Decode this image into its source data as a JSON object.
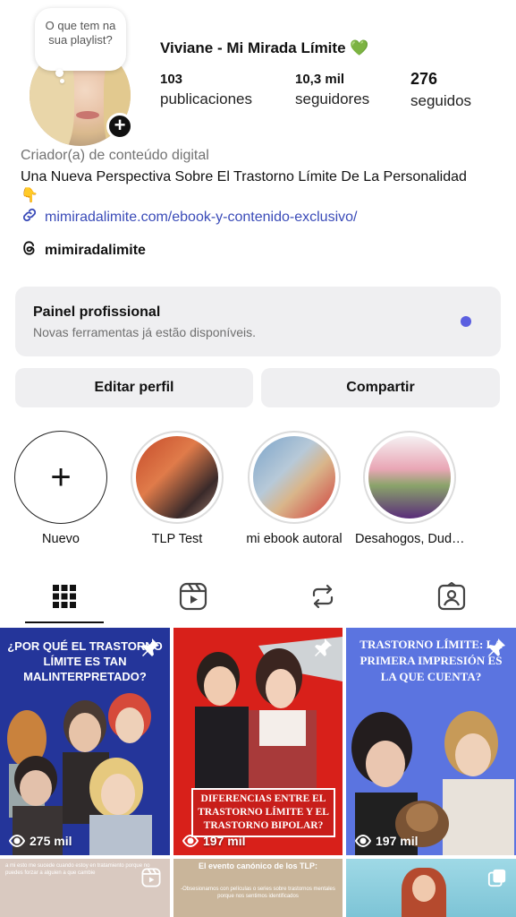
{
  "profile": {
    "note": "O que tem na sua playlist?",
    "display_name": "Viviane - Mi Mirada Límite 💚",
    "stats": [
      {
        "num": "103",
        "label": "publicaciones"
      },
      {
        "num": "10,3 mil",
        "label": "seguidores"
      },
      {
        "num": "276",
        "label": "seguidos"
      }
    ],
    "category": "Criador(a) de conteúdo digital",
    "bio": "Una Nueva Perspectiva Sobre El Trastorno Límite De La Personalidad 👇",
    "link": "mimiradalimite.com/ebook-y-contenido-exclusivo/",
    "threads_handle": "mimiradalimite"
  },
  "panel": {
    "title": "Painel profissional",
    "subtitle": "Novas ferramentas já estão disponíveis.",
    "dot_color": "#5b5fe0"
  },
  "buttons": {
    "edit": "Editar perfil",
    "share": "Compartir"
  },
  "highlights": [
    {
      "label": "Nuevo"
    },
    {
      "label": "TLP Test"
    },
    {
      "label": "mi ebook autoral"
    },
    {
      "label": "Desahogos, Dud…"
    }
  ],
  "tabs": [
    {
      "icon": "grid-icon"
    },
    {
      "icon": "reels-icon"
    },
    {
      "icon": "reposts-icon"
    },
    {
      "icon": "tagged-icon"
    }
  ],
  "posts": [
    {
      "caption": "¿POR QUÉ EL TRASTORNO LÍMITE ES TAN MALINTERPRETADO?",
      "views": "275 mil",
      "pinned": true
    },
    {
      "caption": "DIFERENCIAS ENTRE EL TRASTORNO LÍMITE Y EL TRASTORNO BIPOLAR?",
      "views": "197 mil",
      "pinned": true
    },
    {
      "caption": "TRASTORNO LÍMITE: LA PRIMERA IMPRESIÓN ES LA QUE CUENTA?",
      "views": "197 mil",
      "pinned": true
    },
    {
      "caption": "a mi esto me sucede cuando estoy en tratamiento porque no puedes forzar a alguien a que cambie"
    },
    {
      "caption": "El evento canónico de los TLP:",
      "subcaption": "-Obsesionarnos con películas o series sobre trastornos mentales porque nos sentimos identificados"
    },
    {
      "caption": ""
    }
  ],
  "colors": {
    "accent_link": "#3a4bb8",
    "button_bg": "#efeff1",
    "post1_bg": "#24359a",
    "post2_bg": "#d8201a",
    "post3_bg": "#5b74e0"
  }
}
